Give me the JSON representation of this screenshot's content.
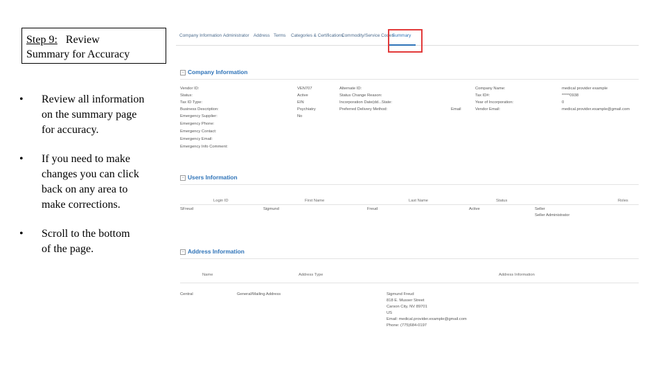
{
  "slide": {
    "step_label": "Step 9:",
    "step_title": "Review",
    "step_title_line2": "Summary for Accuracy",
    "bullets": [
      {
        "lines": [
          "Review all information",
          "on the summary page",
          "for accuracy."
        ]
      },
      {
        "lines": [
          "If you need to make",
          "changes you can click",
          "back on any area to",
          "make corrections."
        ]
      },
      {
        "lines": [
          "Scroll to the bottom",
          "of the page."
        ]
      }
    ],
    "bullet_glyph": "•"
  },
  "screenshot": {
    "tabs": [
      "Company Information",
      "Administrator",
      "Address",
      "Terms",
      "Categories & Certifications",
      "Commodity/Service Codes",
      "Summary"
    ],
    "active_tab": "Summary",
    "highlight_color": "#e23a3a",
    "accent_color": "#2e73b8",
    "company": {
      "title": "Company Information",
      "col1_labels": [
        "Vendor ID:",
        "Status:",
        "Tax ID Type:",
        "Business Description:",
        "Emergency Supplier:",
        "Emergency Phone:",
        "Emergency Contact:",
        "Emergency Email:",
        "Emergency Info Comment:"
      ],
      "col2_values": [
        "VEN707",
        "Active",
        "EIN",
        "Psychiatry",
        "No"
      ],
      "col3_labels": [
        "Alternate ID:",
        "Status Change Reason:",
        "Incorporation Date(dd...State:",
        "Preferred Delivery Method:"
      ],
      "col3_value": "Email",
      "col4_labels": [
        "Company Name:",
        "Tax ID#:",
        "Year of Incorporation:",
        "Vendor Email:"
      ],
      "col5_values": [
        "medical provider example",
        "*****0938",
        "0",
        "medical.provider.example@gmail.com"
      ]
    },
    "users": {
      "title": "Users Information",
      "headers": [
        "Login ID",
        "First Name",
        "Last Name",
        "Status",
        "Roles"
      ],
      "row": [
        "SFreud",
        "Sigmund",
        "Freud",
        "Active",
        "Seller"
      ],
      "row_extra": "Seller Administrator"
    },
    "address": {
      "title": "Address Information",
      "headers": [
        "Name",
        "Address Type",
        "Address Information"
      ],
      "row_name": "Central",
      "row_type": "General/Mailing Address",
      "row_info": [
        "Sigmund Freud",
        "818 E. Musser Street",
        "Carson City, NV 89701",
        "US",
        "Email: medical.provider.example@gmail.com",
        "Phone: (775)684-0197"
      ]
    }
  }
}
